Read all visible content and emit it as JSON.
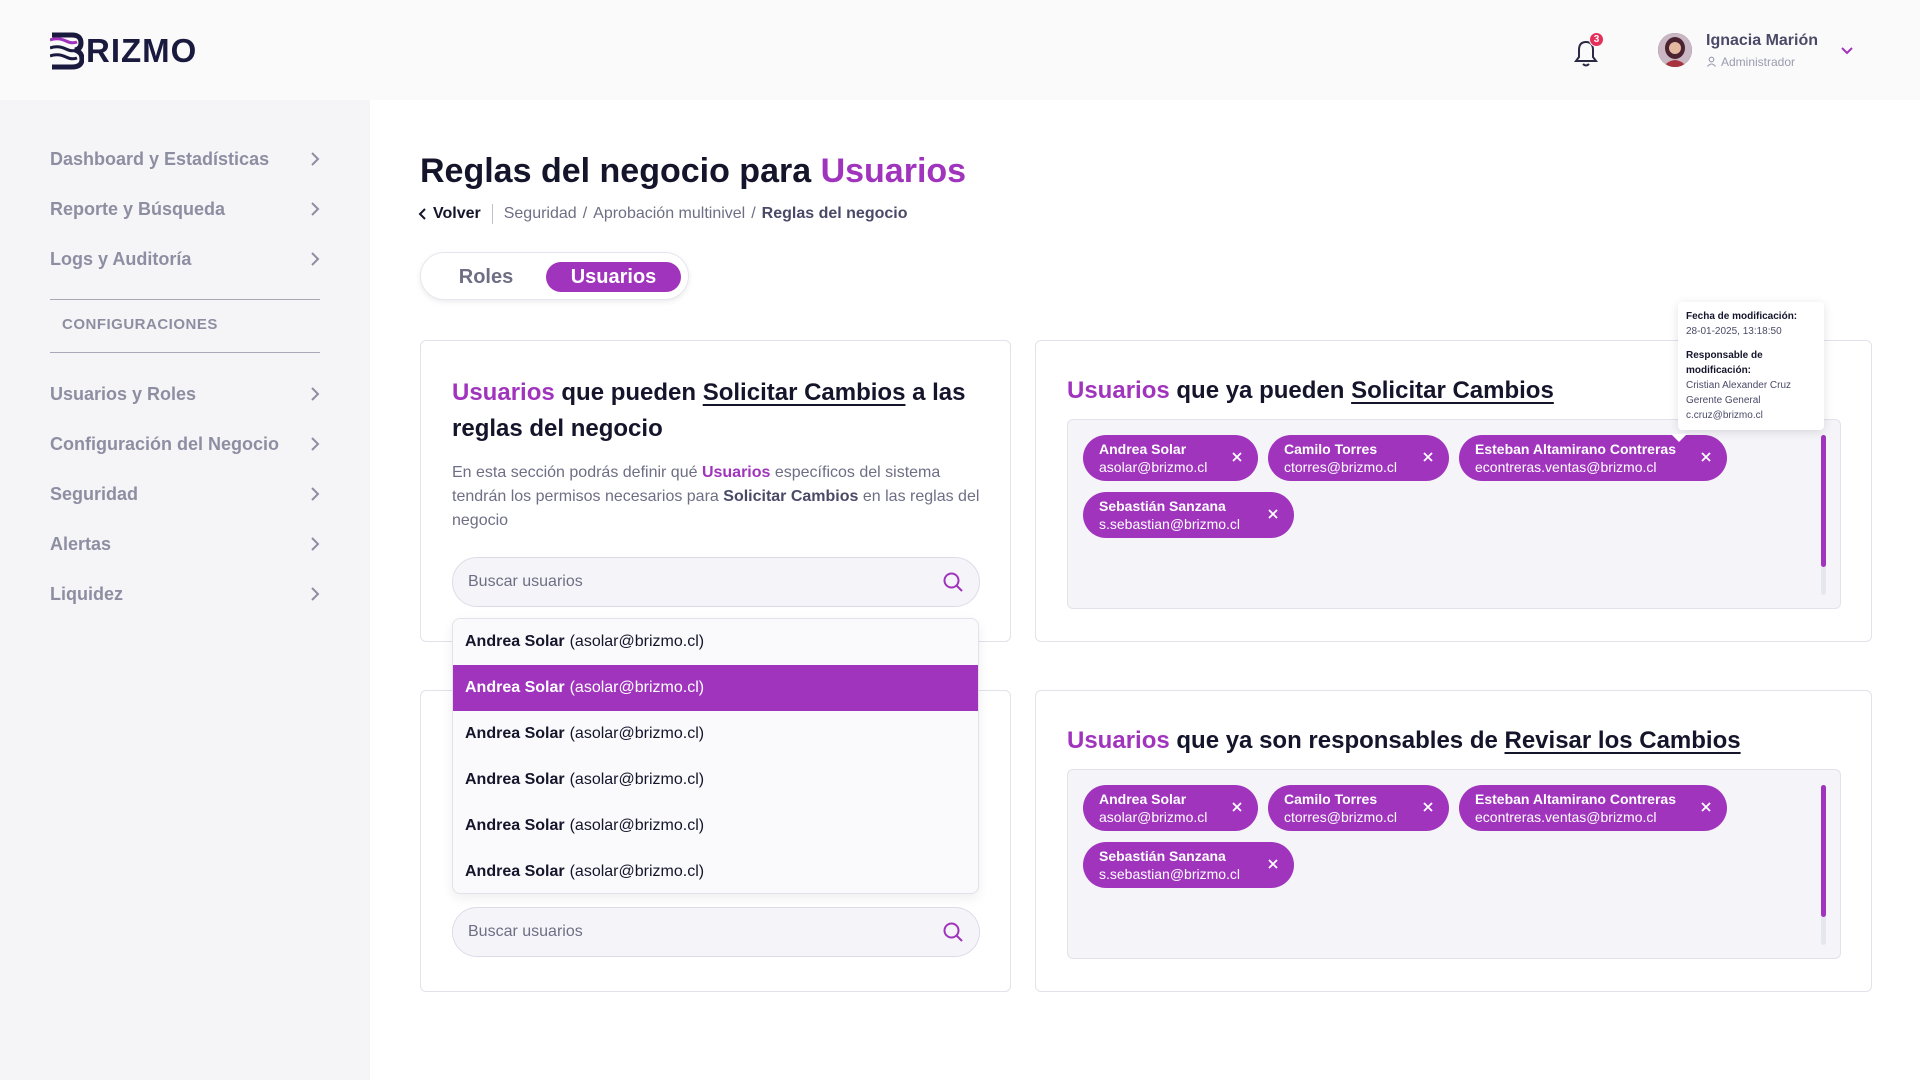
{
  "brand": {
    "name": "RIZMO",
    "logo_mark": "B"
  },
  "header": {
    "notification_count": "3",
    "user": {
      "name": "Ignacia Marión",
      "role": "Administrador"
    }
  },
  "sidebar": {
    "items_top": [
      {
        "label": "Dashboard y Estadísticas"
      },
      {
        "label": "Reporte y Búsqueda"
      },
      {
        "label": "Logs y Auditoría"
      }
    ],
    "section_label": "CONFIGURACIONES",
    "items_bottom": [
      {
        "label": "Usuarios y Roles"
      },
      {
        "label": "Configuración del Negocio"
      },
      {
        "label": "Seguridad"
      },
      {
        "label": "Alertas"
      },
      {
        "label": "Liquidez"
      }
    ]
  },
  "page": {
    "title_prefix": "Reglas del negocio para",
    "title_accent": "Usuarios",
    "breadcrumb": {
      "back": "Volver",
      "items": [
        "Seguridad",
        "Aprobación multinivel"
      ],
      "current": "Reglas del negocio"
    },
    "tabs": {
      "roles": "Roles",
      "users": "Usuarios"
    }
  },
  "card_request": {
    "title_accent": "Usuarios",
    "title_mid": "que pueden",
    "title_link": "Solicitar Cambios",
    "title_suffix": "a las",
    "title_line2": "reglas del negocio",
    "desc_1": "En esta sección podrás definir qué",
    "desc_accent": "Usuarios",
    "desc_2": "específicos del sistema tendrán los permisos necesarios para",
    "desc_bold": "Solicitar Cambios",
    "desc_3": "en las reglas del negocio",
    "search_placeholder": "Buscar usuarios"
  },
  "card_review": {
    "search_placeholder": "Buscar usuarios"
  },
  "dropdown": {
    "items": [
      {
        "name": "Andrea Solar",
        "email": "(asolar@brizmo.cl)"
      },
      {
        "name": "Andrea Solar",
        "email": "(asolar@brizmo.cl)",
        "selected": true
      },
      {
        "name": "Andrea Solar",
        "email": "(asolar@brizmo.cl)"
      },
      {
        "name": "Andrea Solar",
        "email": "(asolar@brizmo.cl)"
      },
      {
        "name": "Andrea Solar",
        "email": "(asolar@brizmo.cl)"
      },
      {
        "name": "Andrea Solar",
        "email": "(asolar@brizmo.cl)"
      }
    ]
  },
  "card_can_request": {
    "title_accent": "Usuarios",
    "title_mid": "que ya pueden",
    "title_link": "Solicitar Cambios",
    "chips": [
      {
        "name": "Andrea Solar",
        "email": "asolar@brizmo.cl"
      },
      {
        "name": "Camilo Torres",
        "email": "ctorres@brizmo.cl"
      },
      {
        "name": "Esteban Altamirano Contreras",
        "email": "econtreras.ventas@brizmo.cl"
      },
      {
        "name": "Sebastián Sanzana",
        "email": "s.sebastian@brizmo.cl"
      }
    ]
  },
  "card_reviewers": {
    "title_accent": "Usuarios",
    "title_mid": "que ya son responsables de",
    "title_link": "Revisar los Cambios",
    "chips": [
      {
        "name": "Andrea Solar",
        "email": "asolar@brizmo.cl"
      },
      {
        "name": "Camilo Torres",
        "email": "ctorres@brizmo.cl"
      },
      {
        "name": "Esteban Altamirano Contreras",
        "email": "econtreras.ventas@brizmo.cl"
      },
      {
        "name": "Sebastián Sanzana",
        "email": "s.sebastian@brizmo.cl"
      }
    ]
  },
  "tooltip": {
    "date_label": "Fecha de modificación:",
    "date_value": "28-01-2025, 13:18:50",
    "resp_label": "Responsable de modificación:",
    "resp_name": "Cristian Alexander Cruz",
    "resp_role": "Gerente General",
    "resp_email": "c.cruz@brizmo.cl"
  },
  "colors": {
    "accent": "#a034bd",
    "text": "#14142b",
    "muted": "#8e8ea3",
    "badge": "#e5305a"
  },
  "icons": [
    "bell-icon",
    "chevron-right-icon",
    "chevron-down-icon",
    "chevron-left-icon",
    "search-icon",
    "close-icon",
    "user-icon"
  ]
}
